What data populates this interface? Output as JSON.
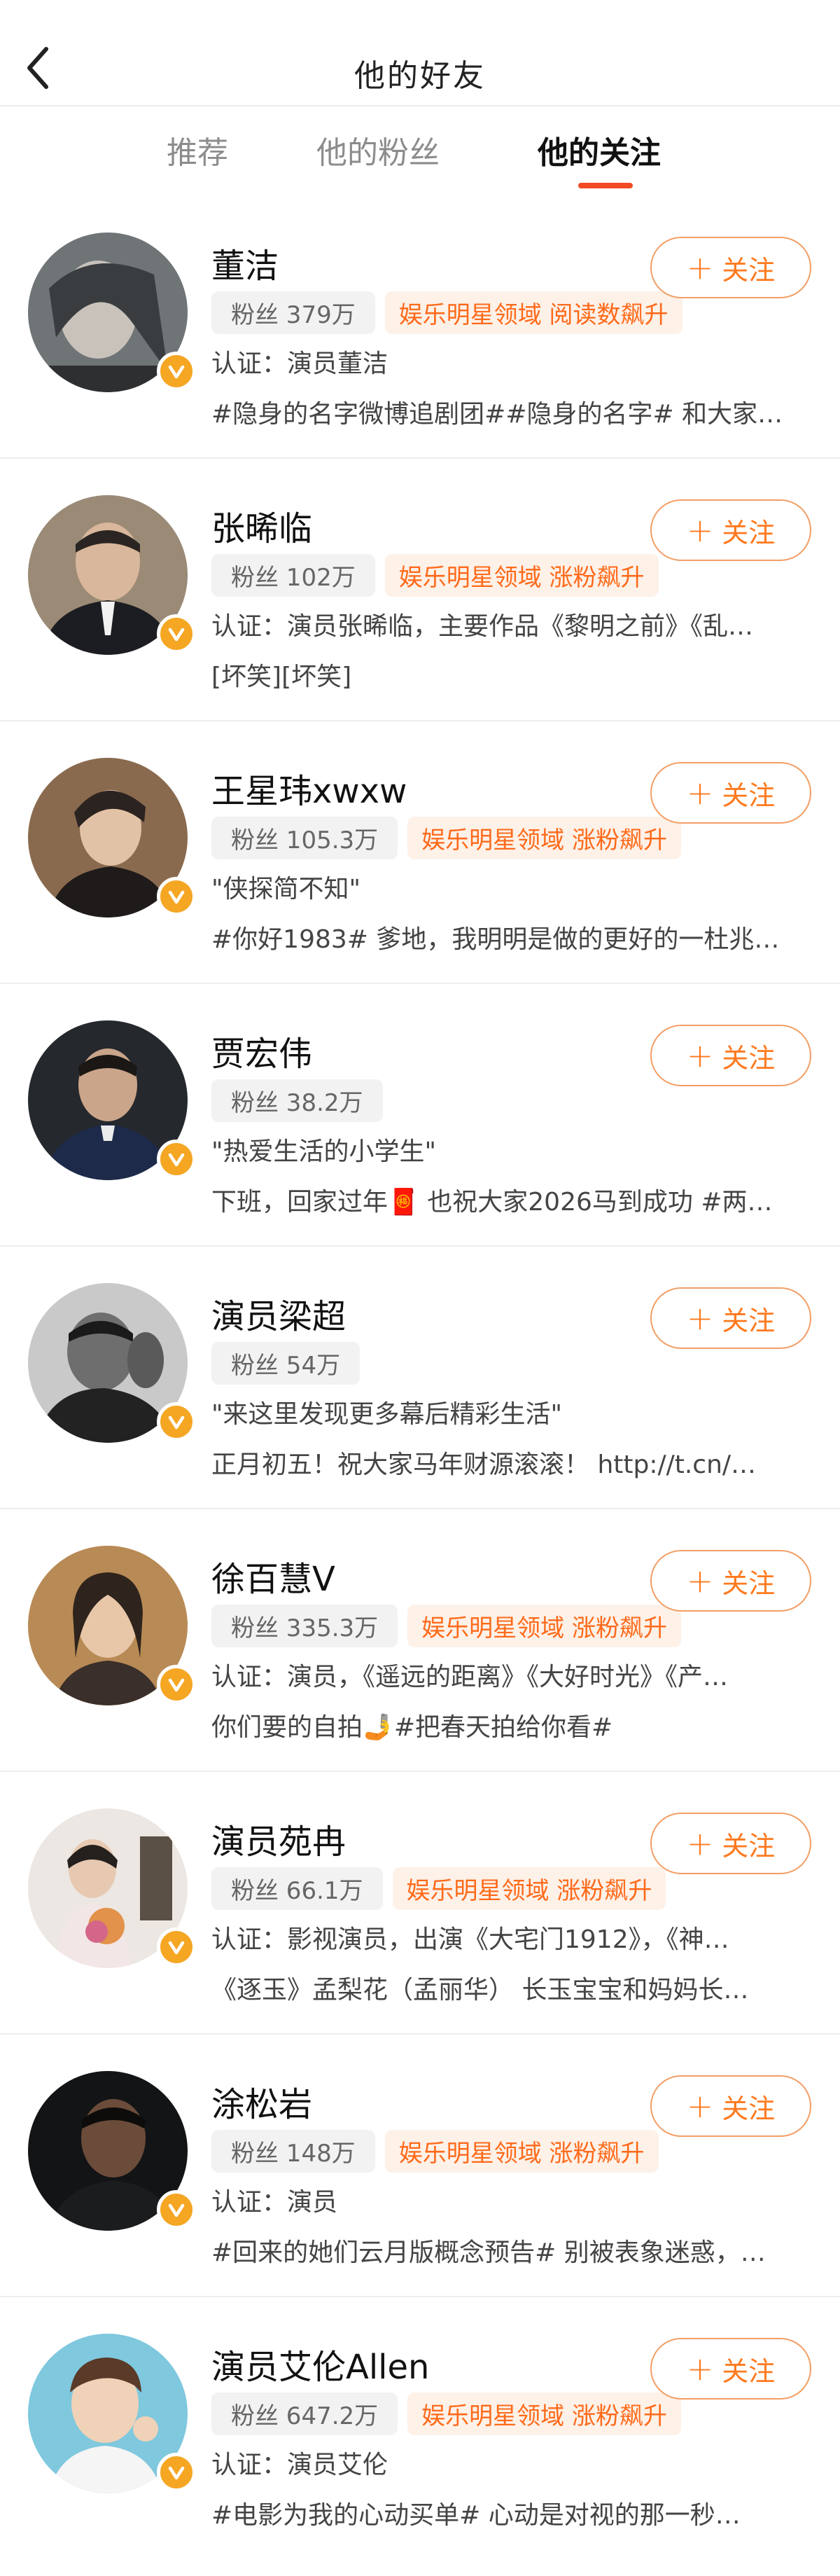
{
  "header": {
    "title": "他的好友",
    "back_icon": "chevron-left-icon"
  },
  "tabs": [
    {
      "label": "推荐",
      "active": false
    },
    {
      "label": "他的粉丝",
      "active": false
    },
    {
      "label": "他的关注",
      "active": true
    }
  ],
  "colors": {
    "accent": "#ff7a1f",
    "tab_indicator": "#f24a24",
    "verified": "#f5a623"
  },
  "follow_label": "关注",
  "users": [
    {
      "name": "董洁",
      "fans": "粉丝 379万",
      "tag": "娱乐明星领域 阅读数飙升",
      "line1": "认证：演员董洁",
      "line2": "#隐身的名字微博追剧团##隐身的名字# 和大家…"
    },
    {
      "name": "张晞临",
      "fans": "粉丝 102万",
      "tag": "娱乐明星领域 涨粉飙升",
      "line1": "认证：演员张晞临，主要作品《黎明之前》《乱…",
      "line2": "[坏笑][坏笑]"
    },
    {
      "name": "王星玮xwxw",
      "fans": "粉丝 105.3万",
      "tag": "娱乐明星领域 涨粉飙升",
      "line1": "\"侠探简不知\"",
      "line2": "#你好1983# 爹地，我明明是做的更好的一杜兆…"
    },
    {
      "name": "贾宏伟",
      "fans": "粉丝 38.2万",
      "tag": "",
      "line1": "\"热爱生活的小学生\"",
      "line2": "下班，回家过年🧧 也祝大家2026马到成功 #两…"
    },
    {
      "name": "演员梁超",
      "fans": "粉丝 54万",
      "tag": "",
      "line1": "\"来这里发现更多幕后精彩生活\"",
      "line2": "正月初五！祝大家马年财源滚滚！ http://t.cn/…"
    },
    {
      "name": "徐百慧V",
      "fans": "粉丝 335.3万",
      "tag": "娱乐明星领域 涨粉飙升",
      "line1": "认证：演员，《遥远的距离》《大好时光》《产…",
      "line2": "你们要的自拍🤳#把春天拍给你看#"
    },
    {
      "name": "演员苑冉",
      "fans": "粉丝 66.1万",
      "tag": "娱乐明星领域 涨粉飙升",
      "line1": "认证：影视演员，出演《大宅门1912》，《神…",
      "line2": "《逐玉》孟梨花（孟丽华） 长玉宝宝和妈妈长…"
    },
    {
      "name": "涂松岩",
      "fans": "粉丝 148万",
      "tag": "娱乐明星领域 涨粉飙升",
      "line1": "认证：演员",
      "line2": "#回来的她们云月版概念预告# 别被表象迷惑，…"
    },
    {
      "name": "演员艾伦Allen",
      "fans": "粉丝 647.2万",
      "tag": "娱乐明星领域 涨粉飙升",
      "line1": "认证：演员艾伦",
      "line2": "#电影为我的心动买单# 心动是对视的那一秒…"
    }
  ]
}
